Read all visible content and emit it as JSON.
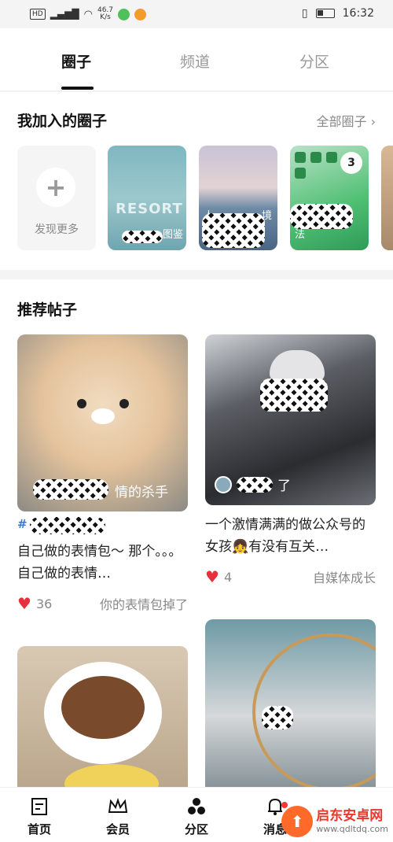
{
  "status": {
    "hd": "HD",
    "network": "4G",
    "speed": "46.7\nK/s",
    "time": "16:32"
  },
  "tabs": [
    {
      "label": "圈子",
      "active": true
    },
    {
      "label": "频道",
      "active": false
    },
    {
      "label": "分区",
      "active": false
    }
  ],
  "circles": {
    "title": "我加入的圈子",
    "all_link": "全部圈子",
    "discover_label": "发现更多",
    "cards": [
      {
        "caption": "RESORT",
        "sub": "图鉴"
      },
      {
        "caption": "人",
        "sub": "境"
      },
      {
        "caption": "法",
        "sub": "3"
      }
    ]
  },
  "recommend": {
    "title": "推荐帖子",
    "posts": [
      {
        "author_suffix": "情的杀手",
        "tag": "#",
        "text": "自己做的表情包～ 那个。。。自己做的表情…",
        "likes": "36",
        "channel": "你的表情包掉了"
      },
      {
        "author_suffix": "了",
        "text": "一个激情满满的做公众号的女孩👧有没有互关…",
        "likes": "4",
        "channel": "自媒体成长"
      }
    ]
  },
  "bottom_nav": [
    {
      "label": "首页"
    },
    {
      "label": "会员"
    },
    {
      "label": "分区"
    },
    {
      "label": "消息"
    }
  ],
  "watermark": {
    "name": "启东安卓网",
    "url": "www.qdltdq.com"
  }
}
